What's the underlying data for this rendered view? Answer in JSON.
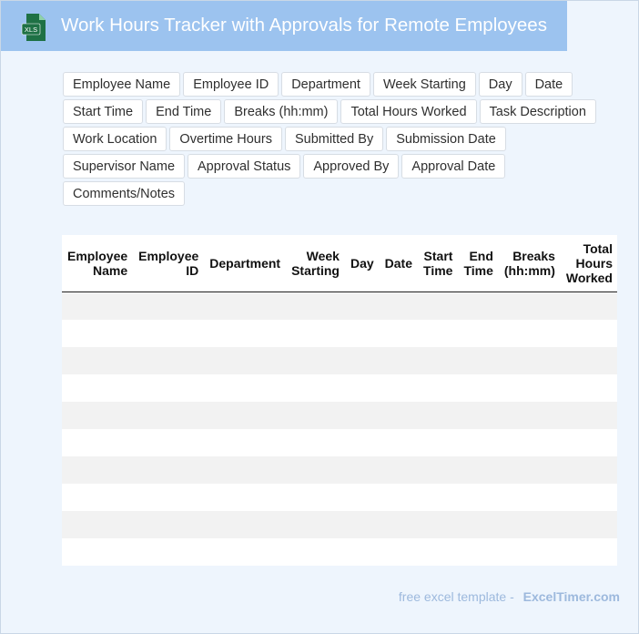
{
  "header": {
    "title": "Work Hours Tracker with Approvals for Remote Employees",
    "icon": "xls-file-icon",
    "icon_label": "XLS",
    "colors": {
      "title_bar": "#9cc3ef",
      "icon_green": "#1e7145"
    }
  },
  "fields": [
    "Employee Name",
    "Employee ID",
    "Department",
    "Week Starting",
    "Day",
    "Date",
    "Start Time",
    "End Time",
    "Breaks (hh:mm)",
    "Total Hours Worked",
    "Task Description",
    "Work Location",
    "Overtime Hours",
    "Submitted By",
    "Submission Date",
    "Supervisor Name",
    "Approval Status",
    "Approved By",
    "Approval Date",
    "Comments/Notes"
  ],
  "table": {
    "headers": [
      [
        "Employee",
        "Name"
      ],
      [
        "Employee",
        "ID"
      ],
      [
        "Department"
      ],
      [
        "Week",
        "Starting"
      ],
      [
        "Day"
      ],
      [
        "Date"
      ],
      [
        "Start",
        "Time"
      ],
      [
        "End",
        "Time"
      ],
      [
        "Breaks",
        "(hh:mm)"
      ],
      [
        "Total",
        "Hours",
        "Worked"
      ]
    ],
    "empty_rows": 10
  },
  "footer": {
    "prefix": "free excel template -",
    "brand": "ExcelTimer.com"
  }
}
